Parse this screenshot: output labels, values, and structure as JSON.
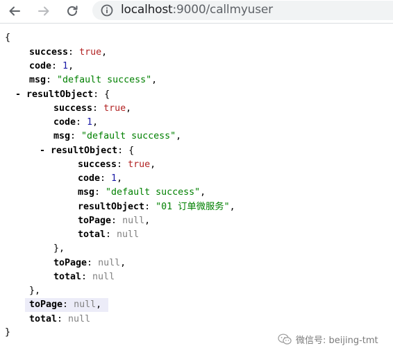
{
  "browser": {
    "url_host": "localhost",
    "url_port": ":9000",
    "url_path": "/callmyuser",
    "icons": [
      "back-arrow-icon",
      "forward-arrow-icon",
      "reload-icon",
      "info-icon"
    ]
  },
  "json_view": {
    "open_brace": "{",
    "close_brace": "}",
    "colon": ": ",
    "comma": ",",
    "collapse_toggle": "- ",
    "inner_close_comma": "},",
    "root": {
      "success_key": "success",
      "success_val": "true",
      "code_key": "code",
      "code_val": "1",
      "msg_key": "msg",
      "msg_val": "\"default success\"",
      "result_key": "resultObject",
      "topage_key": "toPage",
      "topage_val": "null",
      "total_key": "total",
      "total_val": "null"
    },
    "level1": {
      "success_key": "success",
      "success_val": "true",
      "code_key": "code",
      "code_val": "1",
      "msg_key": "msg",
      "msg_val": "\"default success\"",
      "result_key": "resultObject",
      "topage_key": "toPage",
      "topage_val": "null",
      "total_key": "total",
      "total_val": "null"
    },
    "level2": {
      "success_key": "success",
      "success_val": "true",
      "code_key": "code",
      "code_val": "1",
      "msg_key": "msg",
      "msg_val": "\"default success\"",
      "result_key": "resultObject",
      "result_val": "\"01 订单微服务\"",
      "topage_key": "toPage",
      "topage_val": "null",
      "total_key": "total",
      "total_val": "null"
    }
  },
  "watermark": {
    "text": "微信号: beijing-tmt",
    "icon": "wechat-icon"
  }
}
